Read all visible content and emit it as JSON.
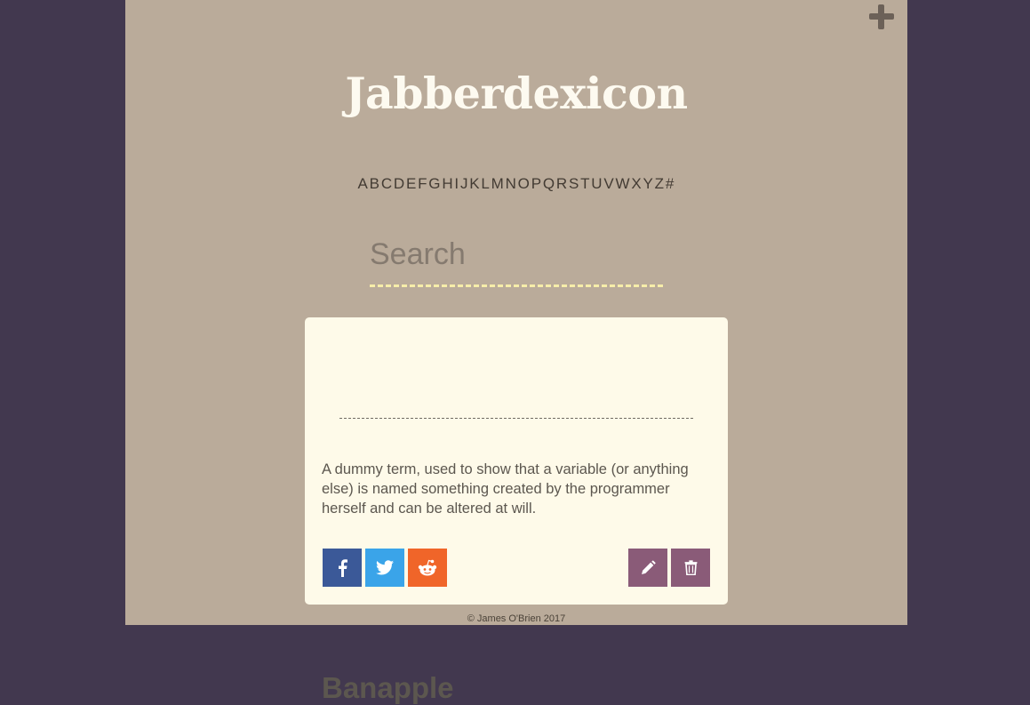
{
  "app": {
    "title": "Jabberdexicon"
  },
  "colors": {
    "background": "#42384f",
    "page": "#baab9a",
    "card": "#fefae9",
    "facebook": "#3b5998",
    "twitter": "#3aa4e9",
    "reddit": "#f06529",
    "action": "#8a5b78",
    "search_underline": "#f6eda9"
  },
  "alphabet": [
    "A",
    "B",
    "C",
    "D",
    "E",
    "F",
    "G",
    "H",
    "I",
    "J",
    "K",
    "L",
    "M",
    "N",
    "O",
    "P",
    "Q",
    "R",
    "S",
    "T",
    "U",
    "V",
    "W",
    "X",
    "Y",
    "Z",
    "#"
  ],
  "search": {
    "placeholder": "Search",
    "value": ""
  },
  "entry": {
    "term": "Banapple",
    "definition": "A dummy term, used to show that a variable (or anything else) is named something created by the programmer herself and can be altered at will.",
    "share_buttons": [
      {
        "name": "facebook",
        "icon": "facebook-icon"
      },
      {
        "name": "twitter",
        "icon": "twitter-icon"
      },
      {
        "name": "reddit",
        "icon": "reddit-icon"
      }
    ],
    "action_buttons": [
      {
        "name": "edit",
        "icon": "pencil-icon"
      },
      {
        "name": "delete",
        "icon": "trash-icon"
      }
    ]
  },
  "header": {
    "add_icon": "plus-icon"
  },
  "footer": {
    "text": "© James O'Brien 2017"
  }
}
